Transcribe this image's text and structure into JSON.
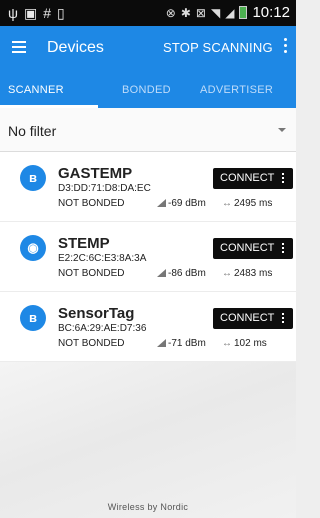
{
  "status_bar": {
    "left_icons": [
      "usb-icon",
      "image-icon",
      "hash-icon",
      "file-icon"
    ],
    "right_icons": [
      "nfc-icon",
      "bluetooth-icon",
      "mute-icon",
      "wifi-icon",
      "signal-icon",
      "battery-icon"
    ],
    "time": "10:12"
  },
  "app_bar": {
    "title": "Devices",
    "action": "STOP SCANNING"
  },
  "tabs": [
    {
      "label": "SCANNER",
      "active": true
    },
    {
      "label": "BONDED",
      "active": false
    },
    {
      "label": "ADVERTISER",
      "active": false
    }
  ],
  "filter": {
    "selected": "No filter"
  },
  "devices": [
    {
      "name": "GASTEMP",
      "address": "D3:DD:71:D8:DA:EC",
      "bond": "NOT BONDED",
      "rssi": "-69 dBm",
      "interval": "2495 ms",
      "icon": "bluetooth-icon",
      "connect_label": "CONNECT"
    },
    {
      "name": "STEMP",
      "address": "E2:2C:6C:E3:8A:3A",
      "bond": "NOT BONDED",
      "rssi": "-86 dBm",
      "interval": "2483 ms",
      "icon": "beacon-icon",
      "connect_label": "CONNECT"
    },
    {
      "name": "SensorTag",
      "address": "BC:6A:29:AE:D7:36",
      "bond": "NOT BONDED",
      "rssi": "-71 dBm",
      "interval": "102 ms",
      "icon": "bluetooth-icon",
      "connect_label": "CONNECT"
    }
  ],
  "footer": {
    "text": "Wireless by Nordic"
  },
  "colors": {
    "primary": "#1e88e5",
    "button": "#0d0d0d",
    "status_bar": "#0b0b0b"
  }
}
